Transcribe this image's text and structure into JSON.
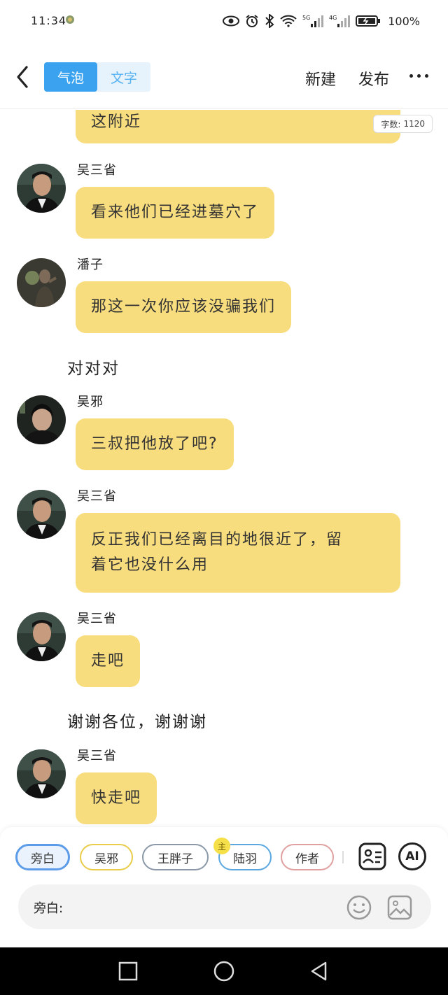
{
  "status_bar": {
    "time": "11:34",
    "battery_text": "100%",
    "network_labels": [
      "5G",
      "4G"
    ]
  },
  "header": {
    "tabs": [
      {
        "label": "气泡",
        "active": true
      },
      {
        "label": "文字",
        "active": false
      }
    ],
    "new_label": "新建",
    "publish_label": "发布"
  },
  "chat": {
    "word_count_label": "字数:",
    "word_count_value": "1120",
    "messages": [
      {
        "type": "bubble",
        "text": "这附近"
      },
      {
        "type": "bubble",
        "speaker": "吴三省",
        "text": "看来他们已经进墓穴了"
      },
      {
        "type": "bubble",
        "speaker": "潘子",
        "text": "那这一次你应该没骗我们"
      },
      {
        "type": "narration",
        "text": "对对对"
      },
      {
        "type": "bubble",
        "speaker": "吴邪",
        "text": "三叔把他放了吧?"
      },
      {
        "type": "bubble",
        "speaker": "吴三省",
        "lines": [
          "反正我们已经离目的地很近了，留",
          "着它也没什么用"
        ]
      },
      {
        "type": "bubble",
        "speaker": "吴三省",
        "text": "走吧"
      },
      {
        "type": "narration",
        "text": "谢谢各位，谢谢谢"
      },
      {
        "type": "bubble",
        "speaker": "吴三省",
        "text": "快走吧"
      }
    ]
  },
  "bottom": {
    "roles": [
      {
        "label": "旁白",
        "color": "#5b9be8",
        "selected": true
      },
      {
        "label": "吴邪",
        "color": "#e8cc4a"
      },
      {
        "label": "王胖子",
        "color": "#8a98a8"
      },
      {
        "label": "陆羽",
        "color": "#5ba8e0"
      },
      {
        "label": "作者",
        "color": "#e0a0a0"
      }
    ],
    "host_badge": "主",
    "ai_label": "AI",
    "input_prefix": "旁白:",
    "input_value": ""
  }
}
